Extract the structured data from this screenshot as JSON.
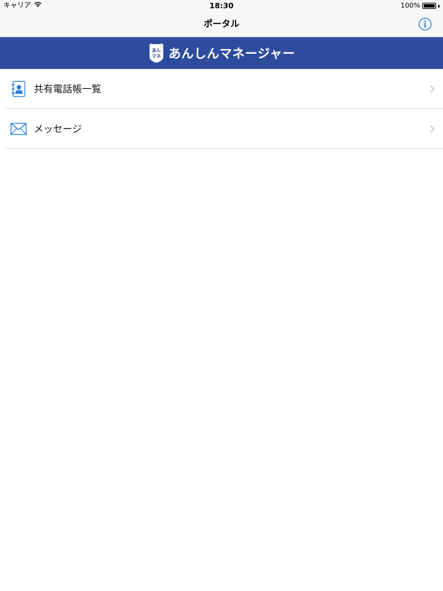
{
  "status_bar": {
    "carrier": "キャリア",
    "time": "18:30",
    "battery": "100%"
  },
  "nav": {
    "title": "ポータル"
  },
  "banner": {
    "logo_line1": "あん",
    "logo_line2": "マネ",
    "brand_name": "あんしんマネージャー"
  },
  "menu": {
    "items": [
      {
        "label": "共有電話帳一覧",
        "icon": "address-book-icon"
      },
      {
        "label": "メッセージ",
        "icon": "envelope-icon"
      }
    ]
  },
  "colors": {
    "banner": "#2e4c9e",
    "accent": "#2b7fd8"
  }
}
